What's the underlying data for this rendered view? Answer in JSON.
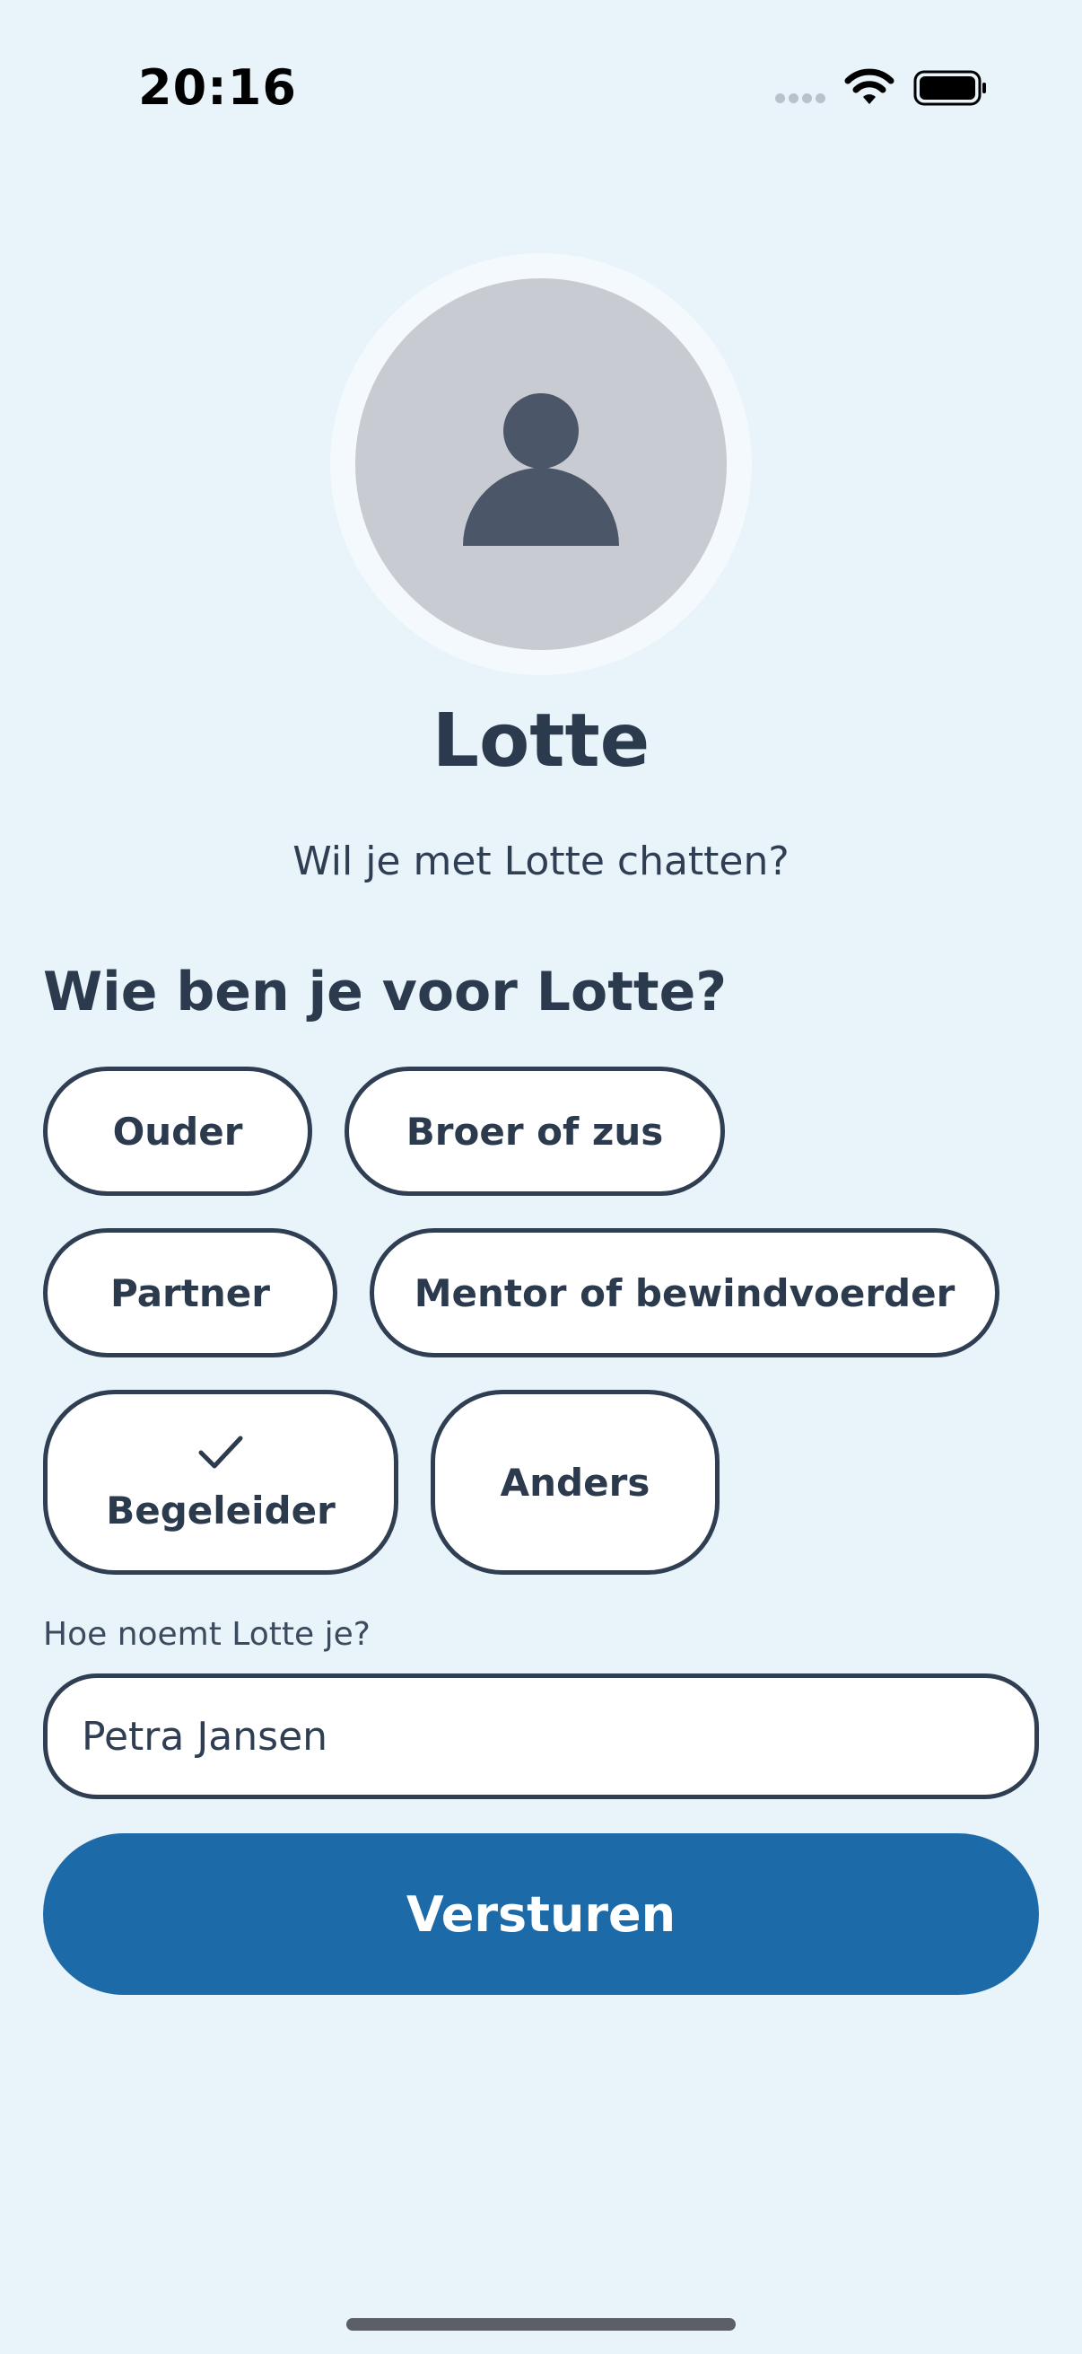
{
  "status_bar": {
    "time": "20:16",
    "icons": [
      "cellular-signal-icon",
      "wifi-icon",
      "battery-icon"
    ]
  },
  "contact": {
    "name": "Lotte",
    "avatar_icon": "person-icon",
    "prompt": "Wil je met Lotte chatten?"
  },
  "relationship": {
    "heading": "Wie ben je voor Lotte?",
    "options": [
      {
        "label": "Ouder",
        "selected": false
      },
      {
        "label": "Broer of zus",
        "selected": false
      },
      {
        "label": "Partner",
        "selected": false
      },
      {
        "label": "Mentor of bewindvoerder",
        "selected": false
      },
      {
        "label": "Begeleider",
        "selected": true
      },
      {
        "label": "Anders",
        "selected": false
      }
    ]
  },
  "name_field": {
    "label": "Hoe noemt Lotte je?",
    "value": "Petra Jansen"
  },
  "submit": {
    "label": "Versturen"
  },
  "colors": {
    "background": "#e8f3fa",
    "accent": "#1c6aa8",
    "text": "#2b3a4d",
    "avatar": "#c8cbd2"
  }
}
